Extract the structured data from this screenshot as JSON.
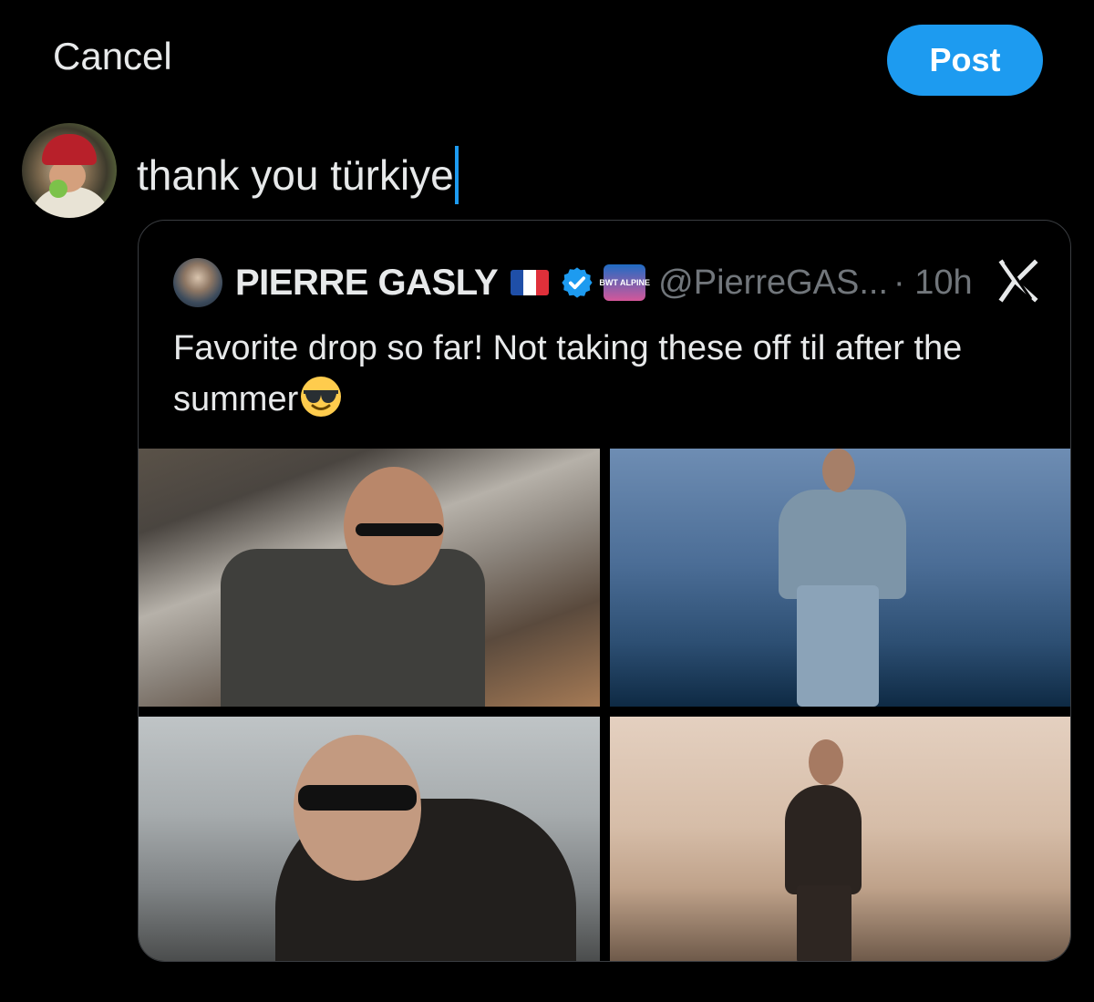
{
  "header": {
    "cancel_label": "Cancel",
    "post_label": "Post"
  },
  "compose": {
    "text": "thank you türkiye"
  },
  "quote": {
    "author_name": "PIERRE GASLY",
    "flag": "🇫🇷",
    "handle": "@PierreGAS...",
    "time": "· 10h",
    "affiliate_badge": "BWT ALPINE",
    "text": "Favorite drop so far! Not taking these off til after the summer",
    "emoji": "smiling-face-with-sunglasses",
    "photo_count": 4
  },
  "colors": {
    "background": "#000000",
    "accent": "#1d9bf0",
    "text_primary": "#e7e9ea",
    "text_secondary": "#71767b",
    "border": "#3a3d41"
  }
}
